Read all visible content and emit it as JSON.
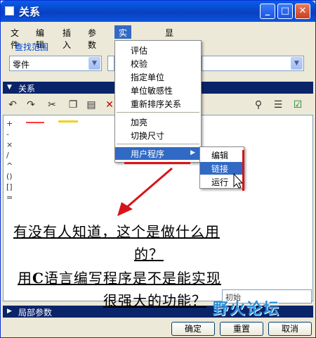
{
  "window": {
    "title": "关系"
  },
  "titlebar": {
    "min": "_",
    "max": "□",
    "close": "✕"
  },
  "menubar": [
    "文件",
    "编辑",
    "插入",
    "参数",
    "实用工具",
    "显示"
  ],
  "scope": {
    "label": "查找范围",
    "combo_value": "零件"
  },
  "section_relations": "关系",
  "operators": [
    "+",
    "-",
    "×",
    "/",
    "^",
    "()",
    "[]",
    "="
  ],
  "dropdown": {
    "items": [
      "评估",
      "校验",
      "指定单位",
      "单位敏感性",
      "重新排序关系",
      "加亮",
      "切换尺寸",
      "用户程序"
    ]
  },
  "submenu": {
    "items": [
      "编辑",
      "链接",
      "运行"
    ]
  },
  "note": {
    "line1": "有没有人知道，这个是做什么用",
    "line2": "的？",
    "line3_pre": "用",
    "line3_c": "C",
    "line3_post": "语言编写程序是不是能实现",
    "line4": "很强大的功能？"
  },
  "bottom": {
    "combo": "初始",
    "section_local": "局部参数",
    "ok": "确定",
    "reset": "重置",
    "cancel": "取消"
  },
  "watermark": "野火论坛"
}
